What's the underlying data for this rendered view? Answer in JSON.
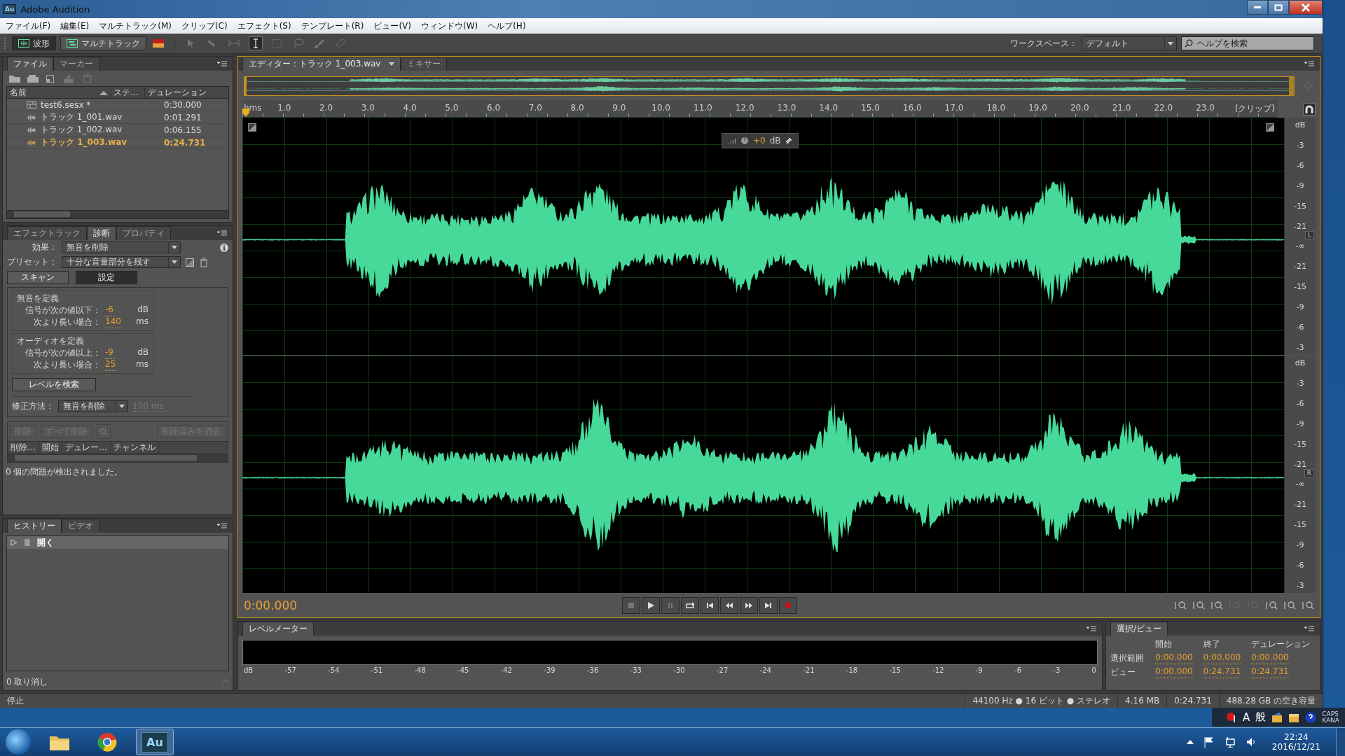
{
  "window": {
    "title": "Adobe Audition",
    "app_icon": "Au"
  },
  "menu": [
    "ファイル(F)",
    "編集(E)",
    "マルチトラック(M)",
    "クリップ(C)",
    "エフェクト(S)",
    "テンプレート(R)",
    "ビュー(V)",
    "ウィンドウ(W)",
    "ヘルプ(H)"
  ],
  "toolbar": {
    "modes": [
      {
        "label": "波形",
        "selected": true
      },
      {
        "label": "マルチトラック",
        "selected": false
      }
    ],
    "workspace_label": "ワークスペース：",
    "workspace": "デフォルト",
    "help_search": {
      "placeholder": "ヘルプを検索"
    }
  },
  "files_panel": {
    "tabs": [
      {
        "label": "ファイル",
        "selected": true
      },
      {
        "label": "マーカー",
        "selected": false
      }
    ],
    "columns": [
      "名前",
      "ステ…",
      "デュレーション"
    ],
    "rows": [
      {
        "kind": "session",
        "name": "test6.sesx *",
        "duration": "0:30.000",
        "selected": false
      },
      {
        "kind": "audio",
        "name": "トラック 1_001.wav",
        "duration": "0:01.291",
        "selected": false
      },
      {
        "kind": "audio",
        "name": "トラック 1_002.wav",
        "duration": "0:06.155",
        "selected": false
      },
      {
        "kind": "audio",
        "name": "トラック 1_003.wav",
        "duration": "0:24.731",
        "selected": true
      }
    ]
  },
  "diagnostics_panel": {
    "tabs": [
      {
        "label": "エフェクトラック",
        "selected": false
      },
      {
        "label": "診断",
        "selected": true
      },
      {
        "label": "プロパティ",
        "selected": false
      }
    ],
    "effect_label": "効果：",
    "effect": "無音を削除",
    "preset_label": "プリセット：",
    "preset": "十分な音量部分を残す",
    "buttons": [
      {
        "label": "スキャン",
        "selected": false
      },
      {
        "label": "設定",
        "selected": true
      }
    ],
    "groups": [
      {
        "title": "無音を定義",
        "fields": [
          {
            "label": "信号が次の値以下：",
            "value": "-6",
            "unit": "dB"
          },
          {
            "label": "次より長い場合：",
            "value": "140",
            "unit": "ms"
          }
        ]
      },
      {
        "title": "オーディオを定義",
        "fields": [
          {
            "label": "信号が次の値以上：",
            "value": "-9",
            "unit": "dB"
          },
          {
            "label": "次より長い場合：",
            "value": "25",
            "unit": "ms"
          }
        ]
      }
    ],
    "find_levels": "レベルを検索",
    "fix_label": "修正方法：",
    "fix": "無音を削除",
    "fix_amount": {
      "value": "100 ms",
      "disabled": true
    },
    "actions": [
      {
        "label": "削除",
        "disabled": true
      },
      {
        "label": "すべて削除",
        "disabled": true
      },
      {
        "label": "削除済みを消去",
        "disabled": true
      }
    ],
    "columns": [
      "削除…",
      "開始",
      "デュレー…",
      "チャンネル"
    ],
    "status": "0 個の問題が検出されました。"
  },
  "history_panel": {
    "tabs": [
      {
        "label": "ヒストリー",
        "selected": true
      },
      {
        "label": "ビデオ",
        "selected": false
      }
    ],
    "items": [
      {
        "label": "開く",
        "selected": true
      }
    ],
    "undo_count": "0 取り消し"
  },
  "editor": {
    "tabs": [
      {
        "label": "エディター：トラック 1_003.wav",
        "selected": true
      },
      {
        "label": "ミキサー",
        "selected": false
      }
    ],
    "ruler": [
      "hms",
      "1.0",
      "2.0",
      "3.0",
      "4.0",
      "5.0",
      "6.0",
      "7.0",
      "8.0",
      "9.0",
      "10.0",
      "11.0",
      "12.0",
      "13.0",
      "14.0",
      "15.0",
      "16.0",
      "17.0",
      "18.0",
      "19.0",
      "20.0",
      "21.0",
      "22.0",
      "23.0"
    ],
    "ruler_end": "(クリップ)",
    "gain_value": "+0",
    "gain_unit": "dB",
    "channels": [
      {
        "label": "L",
        "scale": [
          "dB",
          "-3",
          "-6",
          "-9",
          "-15",
          "-21",
          "-∞",
          "-21",
          "-15",
          "-9",
          "-6",
          "-3"
        ]
      },
      {
        "label": "R",
        "scale": [
          "dB",
          "-3",
          "-6",
          "-9",
          "-15",
          "-21",
          "-∞",
          "-21",
          "-15",
          "-9",
          "-6",
          "-3"
        ]
      }
    ],
    "time": "0:00.000"
  },
  "level_meter": {
    "title": "レベルメーター",
    "scale": [
      "dB",
      "-57",
      "-54",
      "-51",
      "-48",
      "-45",
      "-42",
      "-39",
      "-36",
      "-33",
      "-30",
      "-27",
      "-24",
      "-21",
      "-18",
      "-15",
      "-12",
      "-9",
      "-6",
      "-3",
      "0"
    ]
  },
  "selection_view": {
    "title": "選択/ビュー",
    "columns": [
      "開始",
      "終了",
      "デュレーション"
    ],
    "rows": [
      {
        "label": "選択範囲",
        "values": [
          "0:00.000",
          "0:00.000",
          "0:00.000"
        ]
      },
      {
        "label": "ビュー",
        "values": [
          "0:00.000",
          "0:24.731",
          "0:24.731"
        ]
      }
    ]
  },
  "status_bar": {
    "state": "停止",
    "items": [
      "44100 Hz ● 16 ビット ● ステレオ",
      "4.16 MB",
      "0:24.731",
      "488.28 GB の空き容量"
    ]
  },
  "ime": {
    "mode": "A",
    "dictionary": "般",
    "caps": "CAPS",
    "kana": "KANA"
  },
  "taskbar": {
    "apps": [
      {
        "kind": "explorer",
        "selected": false
      },
      {
        "kind": "chrome",
        "selected": false
      },
      {
        "kind": "audition",
        "label": "Au",
        "selected": true
      }
    ],
    "time": "22:24",
    "date": "2016/12/21"
  }
}
